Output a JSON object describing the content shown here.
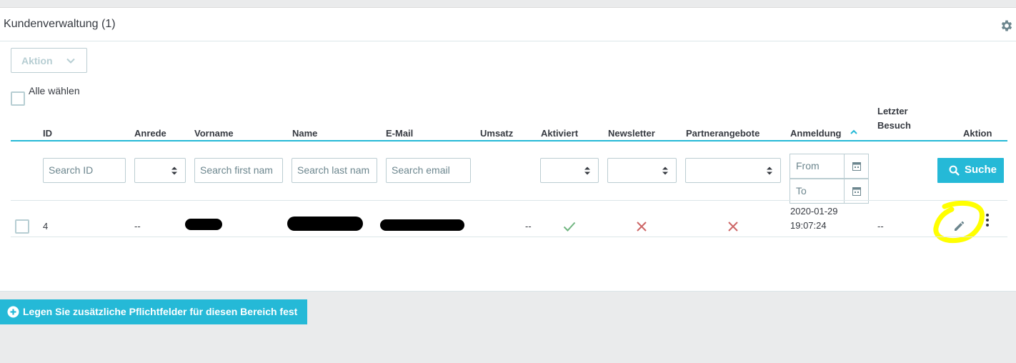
{
  "panel": {
    "title": "Kundenverwaltung (1)"
  },
  "bulk": {
    "action_label": "Aktion",
    "select_all_label": "Alle wählen"
  },
  "columns": {
    "id": "ID",
    "anrede": "Anrede",
    "vorname": "Vorname",
    "name": "Name",
    "email": "E-Mail",
    "umsatz": "Umsatz",
    "aktiviert": "Aktiviert",
    "newsletter": "Newsletter",
    "partner": "Partnerangebote",
    "anmeldung": "Anmeldung",
    "letzter_besuch": "Letzter Besuch",
    "aktion": "Aktion"
  },
  "filters": {
    "id_placeholder": "Search ID",
    "first_name_placeholder": "Search first nam",
    "last_name_placeholder": "Search last nam",
    "email_placeholder": "Search email",
    "date_from": "From",
    "date_to": "To",
    "search_button": "Suche"
  },
  "row": {
    "id": "4",
    "anrede": "--",
    "umsatz": "--",
    "aktiviert": "check-icon",
    "newsletter": "cross-icon",
    "partner": "cross-icon",
    "anmeldung_date": "2020-01-29",
    "anmeldung_time": "19:07:24",
    "letzter_besuch": "--"
  },
  "footer": {
    "button_label": "Legen Sie zusätzliche Pflichtfelder für diesen Bereich fest"
  },
  "colors": {
    "accent": "#25b9d7",
    "success": "#70b580",
    "danger": "#cd6666",
    "highlight": "#ffff00"
  }
}
